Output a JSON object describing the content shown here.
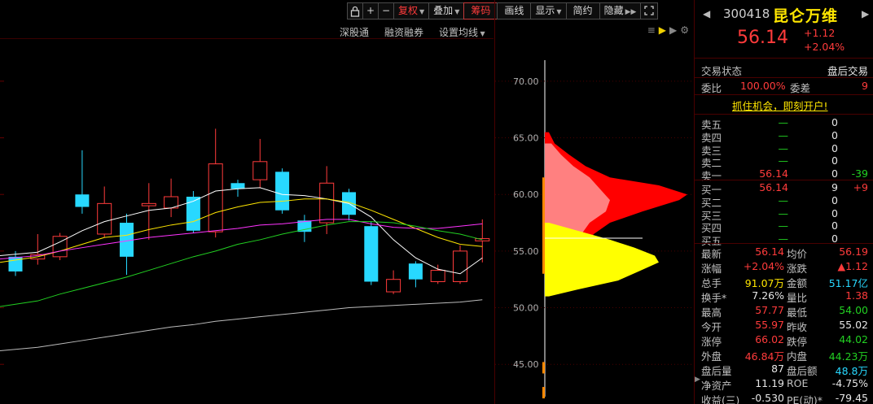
{
  "toolbar": {
    "lock_icon": "lock-icon",
    "plus_label": "+",
    "minus_label": "−",
    "fuquan_label": "复权",
    "diejia_label": "叠加",
    "chouma_label": "筹码",
    "huaxian_label": "画线",
    "xianshi_label": "显示",
    "jianyue_label": "简约",
    "yincang_label": "隐藏",
    "expand_icon": "fullscreen-icon"
  },
  "subbar": {
    "shengutong": "深股通",
    "rongzi": "融资融券",
    "setting_ma": "设置均线"
  },
  "colors": {
    "up": "#ff3b3b",
    "down": "#28d8ff",
    "ma5": "#ffffff",
    "ma10": "#ffe600",
    "ma20": "#ff33ff",
    "ma30": "#22d022",
    "ma60": "#bbbbbb"
  },
  "chart_data": {
    "type": "candlestick",
    "price_axis": {
      "min": 42,
      "max": 72,
      "ticks": [
        70,
        65,
        60,
        55,
        50,
        45
      ]
    },
    "candles": [
      {
        "o": 54.5,
        "c": 53.2,
        "h": 55.0,
        "l": 52.8
      },
      {
        "o": 54.3,
        "c": 54.7,
        "h": 56.5,
        "l": 53.8
      },
      {
        "o": 54.5,
        "c": 56.3,
        "h": 56.6,
        "l": 54.2
      },
      {
        "o": 60.0,
        "c": 58.9,
        "h": 63.9,
        "l": 58.3
      },
      {
        "o": 56.5,
        "c": 59.2,
        "h": 60.7,
        "l": 56.2
      },
      {
        "o": 57.5,
        "c": 54.5,
        "h": 58.3,
        "l": 52.9
      },
      {
        "o": 59.0,
        "c": 59.2,
        "h": 61.0,
        "l": 56.0
      },
      {
        "o": 58.8,
        "c": 59.8,
        "h": 61.4,
        "l": 58.0
      },
      {
        "o": 59.8,
        "c": 56.8,
        "h": 60.3,
        "l": 56.6
      },
      {
        "o": 56.7,
        "c": 62.7,
        "h": 65.8,
        "l": 56.2
      },
      {
        "o": 61.0,
        "c": 60.5,
        "h": 61.3,
        "l": 59.8
      },
      {
        "o": 61.3,
        "c": 62.9,
        "h": 64.9,
        "l": 60.6
      },
      {
        "o": 62.0,
        "c": 58.6,
        "h": 62.3,
        "l": 58.3
      },
      {
        "o": 57.7,
        "c": 56.7,
        "h": 58.2,
        "l": 55.8
      },
      {
        "o": 57.5,
        "c": 61.0,
        "h": 62.5,
        "l": 56.5
      },
      {
        "o": 60.2,
        "c": 58.2,
        "h": 60.5,
        "l": 57.7
      },
      {
        "o": 57.2,
        "c": 52.3,
        "h": 57.6,
        "l": 52.0
      },
      {
        "o": 51.4,
        "c": 52.5,
        "h": 53.3,
        "l": 51.2
      },
      {
        "o": 53.9,
        "c": 52.5,
        "h": 54.1,
        "l": 51.8
      },
      {
        "o": 52.3,
        "c": 53.3,
        "h": 53.8,
        "l": 52.1
      },
      {
        "o": 52.3,
        "c": 55.0,
        "h": 55.5,
        "l": 52.1
      },
      {
        "o": 55.9,
        "c": 56.1,
        "h": 57.8,
        "l": 54.0
      }
    ],
    "ma_lines": [
      {
        "name": "MA5",
        "color": "#ffffff",
        "values": [
          54.6,
          54.9,
          55.8,
          56.8,
          57.6,
          58.1,
          58.6,
          58.8,
          59.4,
          60.3,
          60.5,
          60.6,
          60.0,
          59.9,
          59.6,
          59.2,
          58.0,
          56.0,
          54.4,
          53.4,
          53.0,
          54.4
        ]
      },
      {
        "name": "MA10",
        "color": "#ffe600",
        "values": [
          54.0,
          54.5,
          55.0,
          55.6,
          56.2,
          56.4,
          56.9,
          57.3,
          57.6,
          58.4,
          58.9,
          59.3,
          59.4,
          59.6,
          59.6,
          59.3,
          58.6,
          57.8,
          57.0,
          56.2,
          55.6,
          55.4
        ]
      },
      {
        "name": "MA20",
        "color": "#ff33ff",
        "values": [
          54.3,
          54.6,
          55.0,
          55.3,
          55.6,
          55.9,
          56.2,
          56.4,
          56.6,
          56.8,
          57.0,
          57.3,
          57.4,
          57.6,
          57.8,
          57.8,
          57.4,
          57.1,
          57.0,
          57.0,
          57.2,
          57.4
        ]
      },
      {
        "name": "MA30",
        "color": "#22d022",
        "values": [
          50.1,
          50.6,
          51.2,
          51.7,
          52.2,
          52.7,
          53.3,
          53.9,
          54.5,
          55.0,
          55.6,
          56.0,
          56.5,
          56.9,
          57.3,
          57.6,
          57.6,
          57.5,
          57.2,
          56.8,
          56.5,
          56.0
        ]
      },
      {
        "name": "MA60",
        "color": "#bbbbbb",
        "values": [
          46.2,
          46.5,
          46.8,
          47.1,
          47.4,
          47.7,
          48.0,
          48.3,
          48.5,
          48.8,
          49.0,
          49.2,
          49.4,
          49.6,
          49.8,
          50.0,
          50.1,
          50.2,
          50.3,
          50.4,
          50.5,
          50.7
        ]
      }
    ],
    "chip_distribution": {
      "price_marker": 56.14,
      "layers": [
        {
          "name": "outer",
          "color": "#ff0000",
          "points": [
            [
              52.0,
              10
            ],
            [
              53.5,
              30
            ],
            [
              54.8,
              70
            ],
            [
              55.5,
              50
            ],
            [
              56.5,
              60
            ],
            [
              57.5,
              80
            ],
            [
              58.5,
              120
            ],
            [
              59.5,
              165
            ],
            [
              60.0,
              175
            ],
            [
              60.8,
              140
            ],
            [
              61.5,
              80
            ],
            [
              62.5,
              50
            ],
            [
              63.5,
              30
            ],
            [
              64.5,
              12
            ],
            [
              65.5,
              5
            ]
          ]
        },
        {
          "name": "pink",
          "color": "#ff8080",
          "points": [
            [
              52.3,
              5
            ],
            [
              53.5,
              25
            ],
            [
              54.5,
              45
            ],
            [
              55.5,
              30
            ],
            [
              56.5,
              45
            ],
            [
              57.5,
              55
            ],
            [
              58.5,
              75
            ],
            [
              59.5,
              80
            ],
            [
              60.3,
              70
            ],
            [
              61.5,
              55
            ],
            [
              62.5,
              35
            ],
            [
              63.5,
              20
            ],
            [
              64.5,
              8
            ]
          ]
        },
        {
          "name": "magenta",
          "color": "#ff00aa",
          "points": [
            [
              52.5,
              5
            ],
            [
              53.5,
              22
            ],
            [
              54.5,
              35
            ],
            [
              55.5,
              28
            ],
            [
              56.5,
              15
            ],
            [
              57.5,
              4
            ]
          ]
        },
        {
          "name": "yellow",
          "color": "#ffff00",
          "points": [
            [
              51.0,
              5
            ],
            [
              51.6,
              40
            ],
            [
              52.4,
              90
            ],
            [
              53.2,
              115
            ],
            [
              54.0,
              140
            ],
            [
              54.6,
              135
            ],
            [
              55.3,
              110
            ],
            [
              56.0,
              80
            ],
            [
              56.8,
              40
            ],
            [
              57.5,
              5
            ]
          ]
        }
      ]
    }
  },
  "quote": {
    "code": "300418",
    "name": "昆仑万维",
    "price": "56.14",
    "change": "+1.12",
    "change_pct": "+2.04%",
    "status_label": "交易状态",
    "status_value": "盘后交易",
    "weibi_label": "委比",
    "weibi_value": "100.00%",
    "weicha_label": "委差",
    "weicha_value": "9",
    "ad_text": "抓住机会，即刻开户!",
    "asks": [
      {
        "label": "卖五",
        "price": "—",
        "vol": "0",
        "chg": ""
      },
      {
        "label": "卖四",
        "price": "—",
        "vol": "0",
        "chg": ""
      },
      {
        "label": "卖三",
        "price": "—",
        "vol": "0",
        "chg": ""
      },
      {
        "label": "卖二",
        "price": "—",
        "vol": "0",
        "chg": ""
      },
      {
        "label": "卖一",
        "price": "56.14",
        "vol": "0",
        "chg": "-39"
      }
    ],
    "bids": [
      {
        "label": "买一",
        "price": "56.14",
        "vol": "9",
        "chg": "+9"
      },
      {
        "label": "买二",
        "price": "—",
        "vol": "0",
        "chg": ""
      },
      {
        "label": "买三",
        "price": "—",
        "vol": "0",
        "chg": ""
      },
      {
        "label": "买四",
        "price": "—",
        "vol": "0",
        "chg": ""
      },
      {
        "label": "买五",
        "price": "—",
        "vol": "0",
        "chg": ""
      }
    ],
    "stats": [
      {
        "l1": "最新",
        "v1": "56.14",
        "c1": "red",
        "l2": "均价",
        "v2": "56.19",
        "c2": "red"
      },
      {
        "l1": "涨幅",
        "v1": "+2.04%",
        "c1": "red",
        "l2": "涨跌",
        "v2": "▲1.12",
        "c2": "red"
      },
      {
        "l1": "总手",
        "v1": "91.07万",
        "c1": "yellow",
        "l2": "金额",
        "v2": "51.17亿",
        "c2": "cyan"
      },
      {
        "l1": "换手*",
        "v1": "7.26%",
        "c1": "white",
        "l2": "量比",
        "v2": "1.38",
        "c2": "red"
      },
      {
        "l1": "最高",
        "v1": "57.77",
        "c1": "red",
        "l2": "最低",
        "v2": "54.00",
        "c2": "green"
      },
      {
        "l1": "今开",
        "v1": "55.97",
        "c1": "red",
        "l2": "昨收",
        "v2": "55.02",
        "c2": "white"
      },
      {
        "l1": "涨停",
        "v1": "66.02",
        "c1": "red",
        "l2": "跌停",
        "v2": "44.02",
        "c2": "green"
      },
      {
        "l1": "外盘",
        "v1": "46.84万",
        "c1": "red",
        "l2": "内盘",
        "v2": "44.23万",
        "c2": "green"
      },
      {
        "l1": "盘后量",
        "v1": "87",
        "c1": "white",
        "l2": "盘后额",
        "v2": "48.8万",
        "c2": "cyan"
      },
      {
        "l1": "净资产",
        "v1": "11.19",
        "c1": "white",
        "l2": "ROE",
        "v2": "-4.75%",
        "c2": "white"
      },
      {
        "l1": "收益(三)",
        "v1": "-0.530",
        "c1": "white",
        "l2": "PE(动)*",
        "v2": "-79.45",
        "c2": "white"
      }
    ]
  }
}
